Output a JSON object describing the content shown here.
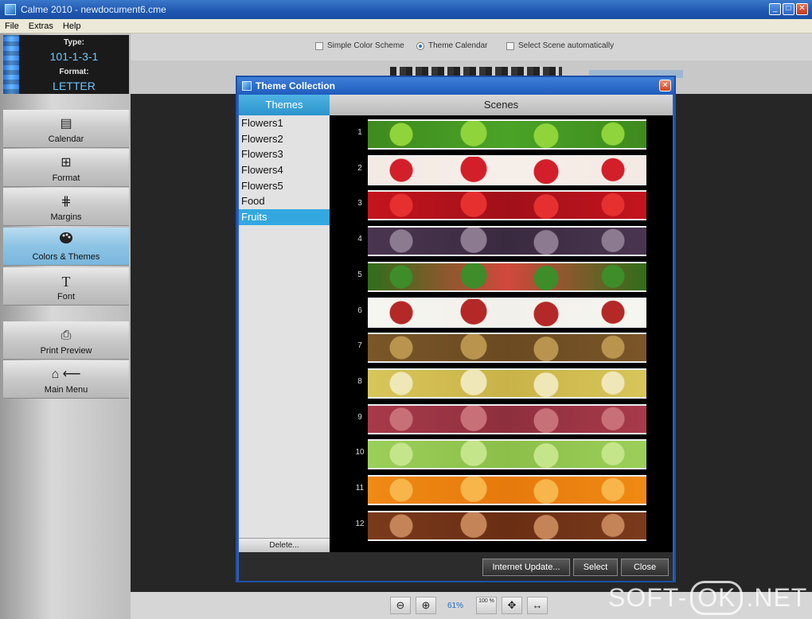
{
  "window": {
    "title": "Calme 2010 - newdocument6.cme"
  },
  "menu": [
    "File",
    "Extras",
    "Help"
  ],
  "info": {
    "type_label": "Type:",
    "type_value": "101-1-3-1",
    "format_label": "Format:",
    "format_value": "LETTER"
  },
  "nav": [
    {
      "label": "Calendar",
      "icon": "calendar-icon",
      "glyph": "▤",
      "active": false
    },
    {
      "label": "Format",
      "icon": "format-icon",
      "glyph": "⊞",
      "active": false
    },
    {
      "label": "Margins",
      "icon": "margins-icon",
      "glyph": "⋕",
      "active": false
    },
    {
      "label": "Colors & Themes",
      "icon": "palette-icon",
      "glyph": "🎨",
      "active": true
    },
    {
      "label": "Font",
      "icon": "font-icon",
      "glyph": "T",
      "active": false
    },
    {
      "label": "Print Preview",
      "icon": "print-preview-icon",
      "glyph": "⎙",
      "active": false
    },
    {
      "label": "Main Menu",
      "icon": "home-back-icon",
      "glyph": "⌂ ⟵",
      "active": false
    }
  ],
  "options": {
    "simple_color": "Simple Color Scheme",
    "theme_calendar": "Theme Calendar",
    "select_scene": "Select Scene automatically"
  },
  "dialog": {
    "title": "Theme Collection",
    "themes_header": "Themes",
    "scenes_header": "Scenes",
    "themes": [
      "Flowers1",
      "Flowers2",
      "Flowers3",
      "Flowers4",
      "Flowers5",
      "Food",
      "Fruits"
    ],
    "selected_theme": "Fruits",
    "delete_label": "Delete...",
    "scenes": [
      {
        "num": "1",
        "colors": [
          "#3f8a1e",
          "#8fd43a",
          "#4aa327"
        ]
      },
      {
        "num": "2",
        "colors": [
          "#f4e9e4",
          "#d31f2a",
          "#f6efe9"
        ]
      },
      {
        "num": "3",
        "colors": [
          "#c4141d",
          "#e63030",
          "#a1101a"
        ]
      },
      {
        "num": "4",
        "colors": [
          "#4a3550",
          "#8b7a90",
          "#3a2a40"
        ]
      },
      {
        "num": "5",
        "colors": [
          "#2f6e1a",
          "#3e8c2a",
          "#d2483c"
        ]
      },
      {
        "num": "6",
        "colors": [
          "#f6f6f0",
          "#b42828",
          "#f2f0ea"
        ]
      },
      {
        "num": "7",
        "colors": [
          "#7a5628",
          "#b8944e",
          "#6b4a22"
        ]
      },
      {
        "num": "8",
        "colors": [
          "#d8c65a",
          "#efe7b8",
          "#c9b348"
        ]
      },
      {
        "num": "9",
        "colors": [
          "#a83a4a",
          "#c87078",
          "#8e2f3e"
        ]
      },
      {
        "num": "10",
        "colors": [
          "#9ccf5a",
          "#c5e58b",
          "#8bbf4a"
        ]
      },
      {
        "num": "11",
        "colors": [
          "#f08a14",
          "#f7b54a",
          "#e67a0c"
        ]
      },
      {
        "num": "12",
        "colors": [
          "#7a3a1c",
          "#c48458",
          "#6a2e14"
        ]
      }
    ],
    "buttons": {
      "internet_update": "Internet Update...",
      "select": "Select",
      "close": "Close"
    }
  },
  "bottom": {
    "zoom": "61%",
    "zoom100": "100 %"
  },
  "watermark": {
    "left": "SOFT-",
    "ok": "OK",
    "right": ".NET"
  }
}
